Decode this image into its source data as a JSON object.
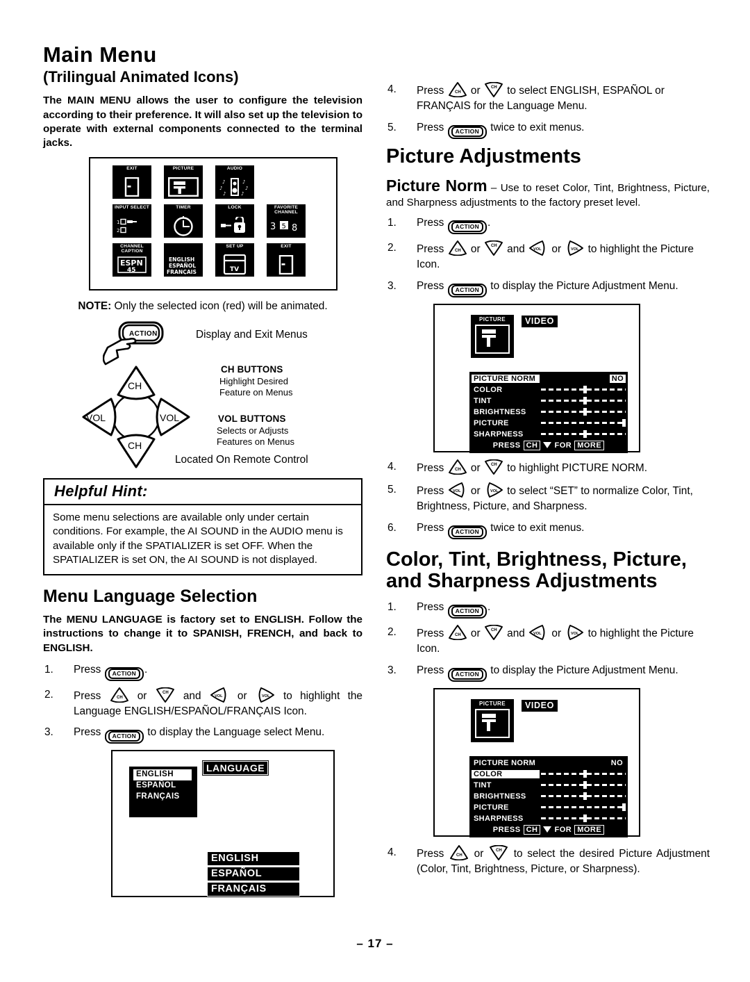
{
  "document": {
    "page_number": "– 17 –"
  },
  "left": {
    "title": "Main Menu",
    "subtitle": "(Trilingual Animated Icons)",
    "intro": "The MAIN MENU allows the user to configure the television according to their preference. It will also set up the television to operate with external components connected to the terminal jacks.",
    "main_menu_icons": [
      [
        {
          "label": "EXIT",
          "glyph": "door-icon"
        },
        {
          "label": "PICTURE",
          "glyph": "picture-screen-icon"
        },
        {
          "label": "AUDIO",
          "glyph": "audio-speaker-icon"
        }
      ],
      [
        {
          "label": "INPUT SELECT",
          "glyph": "input-select-icon"
        },
        {
          "label": "TIMER",
          "glyph": "clock-icon"
        },
        {
          "label": "LOCK",
          "glyph": "padlock-key-icon"
        },
        {
          "label": "FAVORITE CHANNEL",
          "glyph": "favorite-channel-icon"
        }
      ],
      [
        {
          "label": "CHANNEL CAPTION",
          "glyph": "espn-caption-icon",
          "sub": "ESPN 45"
        },
        {
          "label": "",
          "glyph": "language-icon",
          "sub": "ENGLISH ESPAÑOL FRANÇAIS"
        },
        {
          "label": "SET UP",
          "glyph": "setup-tv-icon",
          "sub": "TV"
        },
        {
          "label": "EXIT",
          "glyph": "door-icon"
        }
      ]
    ],
    "note_prefix": "NOTE:",
    "note_text": " Only the selected icon (red) will be animated.",
    "remote": {
      "action_label": "ACTION",
      "action_caption": "Display and Exit Menus",
      "ch_up_label": "CH",
      "ch_down_label": "CH",
      "vol_left_label": "VOL",
      "vol_right_label": "VOL",
      "ch_buttons_title": "CH BUTTONS",
      "ch_buttons_desc_1": "Highlight Desired",
      "ch_buttons_desc_2": "Feature on Menus",
      "vol_buttons_title": "VOL BUTTONS",
      "vol_buttons_desc_1": "Selects or Adjusts",
      "vol_buttons_desc_2": "Features on Menus",
      "located_caption": "Located On Remote Control"
    },
    "hint": {
      "heading": "Helpful Hint:",
      "body": "Some menu selections are available only under certain conditions. For example, the AI SOUND in the AUDIO menu is available only if the SPATIALIZER is set OFF. When the SPATIALIZER is set ON, the AI SOUND is not displayed."
    },
    "language_section": {
      "heading": "Menu Language Selection",
      "intro": "The MENU LANGUAGE is factory set to ENGLISH. Follow the instructions to change it to SPANISH, FRENCH, and back to ENGLISH.",
      "steps": [
        {
          "num": "1.",
          "pre": "Press ",
          "btn": "ACTION",
          "post": "."
        },
        {
          "num": "2.",
          "pre": "Press ",
          "keys": "updownleftright",
          "post": " to highlight the Language ENGLISH/ESPAÑOL/FRANÇAIS Icon."
        },
        {
          "num": "3.",
          "pre": "Press ",
          "btn": "ACTION",
          "post": " to display the Language select Menu."
        }
      ],
      "osd": {
        "title": "LANGUAGE",
        "items": [
          "ENGLISH",
          "ESPAÑOL",
          "FRANÇAIS"
        ],
        "selected": "ENGLISH",
        "second_list": [
          "ENGLISH",
          "ESPAÑOL",
          "FRANÇAIS"
        ]
      }
    }
  },
  "right": {
    "lang_steps_cont": [
      {
        "num": "4.",
        "pre": "Press ",
        "keys": "updown",
        "post": " to select ENGLISH, ESPAÑOL or FRANÇAIS for the Language Menu."
      },
      {
        "num": "5.",
        "pre": "Press ",
        "btn": "ACTION",
        "post": " twice to exit menus."
      }
    ],
    "picture_adjustments": {
      "heading": "Picture Adjustments",
      "norm_lead": "Picture Norm",
      "norm_dash": " – ",
      "norm_text": "Use to reset Color, Tint, Brightness, Picture, and Sharpness adjustments to the factory preset level.",
      "steps": [
        {
          "num": "1.",
          "pre": "Press ",
          "btn": "ACTION",
          "post": "."
        },
        {
          "num": "2.",
          "pre": "Press ",
          "keys": "updownleftright",
          "post": " to highlight the Picture Icon."
        },
        {
          "num": "3.",
          "pre": "Press ",
          "btn": "ACTION",
          "post": " to display the Picture Adjustment Menu."
        }
      ],
      "steps_after": [
        {
          "num": "4.",
          "pre": "Press ",
          "keys": "updown",
          "post": " to highlight PICTURE NORM."
        },
        {
          "num": "5.",
          "pre": "Press ",
          "keys": "leftright",
          "post": " to select “SET” to normalize Color, Tint, Brightness, Picture, and Sharpness."
        },
        {
          "num": "6.",
          "pre": "Press ",
          "btn": "ACTION",
          "post": " twice to exit menus."
        }
      ],
      "osd": {
        "icon_label": "PICTURE",
        "video_tag": "VIDEO",
        "norm_row": {
          "label": "PICTURE NORM",
          "value": "NO"
        },
        "rows": [
          {
            "label": "COLOR",
            "knob_pct": 50
          },
          {
            "label": "TINT",
            "knob_pct": 50
          },
          {
            "label": "BRIGHTNESS",
            "knob_pct": 50
          },
          {
            "label": "PICTURE",
            "knob_pct": 97
          },
          {
            "label": "SHARPNESS",
            "knob_pct": 50
          }
        ],
        "footer_pre": "PRESS",
        "footer_chip": "CH",
        "footer_post": "FOR",
        "footer_more": "MORE",
        "highlighted": "PICTURE NORM"
      }
    },
    "cts_adjustments": {
      "heading": "Color, Tint, Brightness, Picture, and Sharpness Adjustments",
      "steps": [
        {
          "num": "1.",
          "pre": "Press ",
          "btn": "ACTION",
          "post": "."
        },
        {
          "num": "2.",
          "pre": "Press ",
          "keys": "updownleftright",
          "post": " to highlight the Picture Icon."
        },
        {
          "num": "3.",
          "pre": "Press ",
          "btn": "ACTION",
          "post": " to display the Picture Adjustment Menu."
        }
      ],
      "steps_after": [
        {
          "num": "4.",
          "pre": "Press ",
          "keys": "updown",
          "post": " to select the desired Picture Adjustment (Color, Tint, Brightness, Picture, or Sharpness)."
        }
      ],
      "osd": {
        "icon_label": "PICTURE",
        "video_tag": "VIDEO",
        "norm_row": {
          "label": "PICTURE NORM",
          "value": "NO"
        },
        "rows": [
          {
            "label": "COLOR",
            "knob_pct": 50
          },
          {
            "label": "TINT",
            "knob_pct": 50
          },
          {
            "label": "BRIGHTNESS",
            "knob_pct": 50
          },
          {
            "label": "PICTURE",
            "knob_pct": 97
          },
          {
            "label": "SHARPNESS",
            "knob_pct": 50
          }
        ],
        "footer_pre": "PRESS",
        "footer_chip": "CH",
        "footer_post": "FOR",
        "footer_more": "MORE",
        "highlighted": "COLOR"
      }
    }
  }
}
